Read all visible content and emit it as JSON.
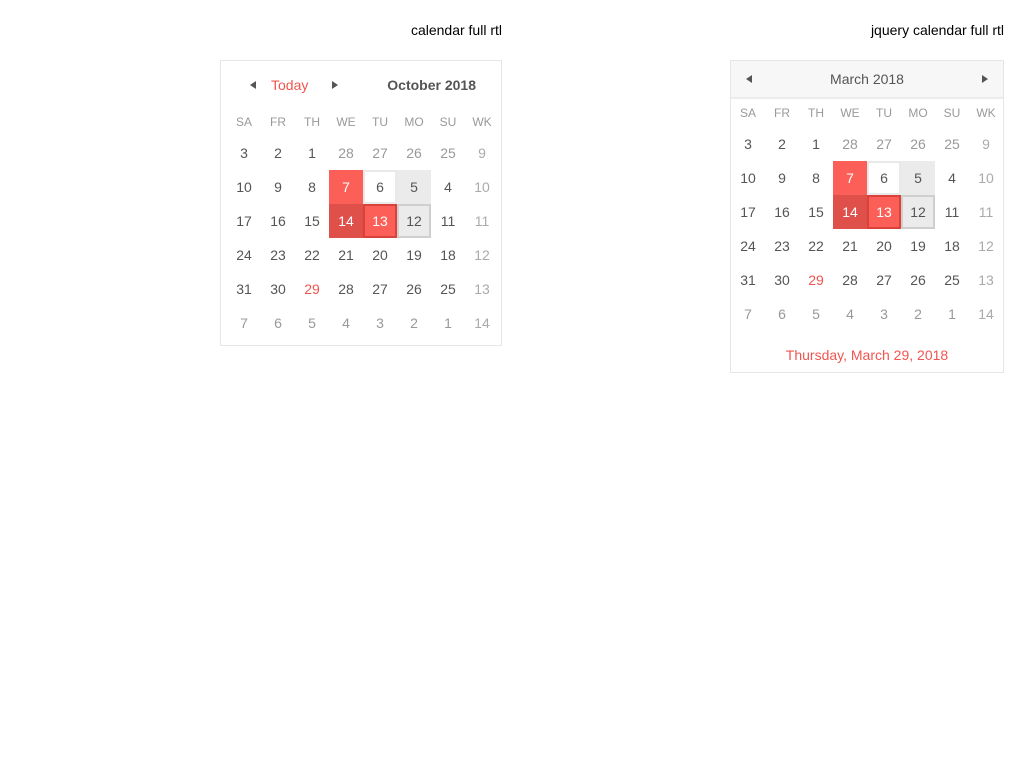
{
  "headings": {
    "left": "calendar full rtl",
    "right": "jquery calendar full rtl"
  },
  "calendar1": {
    "today_label": "Today",
    "month_label": "October 2018",
    "weekdays": [
      "SA",
      "FR",
      "TH",
      "WE",
      "TU",
      "MO",
      "SU",
      "WK"
    ],
    "weeks": [
      [
        {
          "d": "3"
        },
        {
          "d": "2"
        },
        {
          "d": "1"
        },
        {
          "d": "28",
          "s": "muted"
        },
        {
          "d": "27",
          "s": "muted"
        },
        {
          "d": "26",
          "s": "muted"
        },
        {
          "d": "25",
          "s": "muted"
        },
        {
          "d": "9",
          "s": "wk"
        }
      ],
      [
        {
          "d": "10"
        },
        {
          "d": "9"
        },
        {
          "d": "8"
        },
        {
          "d": "7",
          "s": "sel-red"
        },
        {
          "d": "6",
          "s": "outline"
        },
        {
          "d": "5",
          "s": "grey"
        },
        {
          "d": "4"
        },
        {
          "d": "10",
          "s": "wk"
        }
      ],
      [
        {
          "d": "17"
        },
        {
          "d": "16"
        },
        {
          "d": "15"
        },
        {
          "d": "14",
          "s": "sel-dark"
        },
        {
          "d": "13",
          "s": "sel-red-border"
        },
        {
          "d": "12",
          "s": "grey-border"
        },
        {
          "d": "11"
        },
        {
          "d": "11",
          "s": "wk"
        }
      ],
      [
        {
          "d": "24"
        },
        {
          "d": "23"
        },
        {
          "d": "22"
        },
        {
          "d": "21"
        },
        {
          "d": "20"
        },
        {
          "d": "19"
        },
        {
          "d": "18"
        },
        {
          "d": "12",
          "s": "wk"
        }
      ],
      [
        {
          "d": "31"
        },
        {
          "d": "30"
        },
        {
          "d": "29",
          "s": "red-text"
        },
        {
          "d": "28"
        },
        {
          "d": "27"
        },
        {
          "d": "26"
        },
        {
          "d": "25"
        },
        {
          "d": "13",
          "s": "wk"
        }
      ],
      [
        {
          "d": "7",
          "s": "muted"
        },
        {
          "d": "6",
          "s": "muted"
        },
        {
          "d": "5",
          "s": "muted"
        },
        {
          "d": "4",
          "s": "muted"
        },
        {
          "d": "3",
          "s": "muted"
        },
        {
          "d": "2",
          "s": "muted"
        },
        {
          "d": "1",
          "s": "muted"
        },
        {
          "d": "14",
          "s": "wk"
        }
      ]
    ]
  },
  "calendar2": {
    "month_label": "March 2018",
    "weekdays": [
      "SA",
      "FR",
      "TH",
      "WE",
      "TU",
      "MO",
      "SU",
      "WK"
    ],
    "weeks": [
      [
        {
          "d": "3"
        },
        {
          "d": "2"
        },
        {
          "d": "1"
        },
        {
          "d": "28",
          "s": "muted"
        },
        {
          "d": "27",
          "s": "muted"
        },
        {
          "d": "26",
          "s": "muted"
        },
        {
          "d": "25",
          "s": "muted"
        },
        {
          "d": "9",
          "s": "wk"
        }
      ],
      [
        {
          "d": "10"
        },
        {
          "d": "9"
        },
        {
          "d": "8"
        },
        {
          "d": "7",
          "s": "sel-red"
        },
        {
          "d": "6",
          "s": "outline"
        },
        {
          "d": "5",
          "s": "grey"
        },
        {
          "d": "4"
        },
        {
          "d": "10",
          "s": "wk"
        }
      ],
      [
        {
          "d": "17"
        },
        {
          "d": "16"
        },
        {
          "d": "15"
        },
        {
          "d": "14",
          "s": "sel-dark"
        },
        {
          "d": "13",
          "s": "sel-red-border"
        },
        {
          "d": "12",
          "s": "grey-border"
        },
        {
          "d": "11"
        },
        {
          "d": "11",
          "s": "wk"
        }
      ],
      [
        {
          "d": "24"
        },
        {
          "d": "23"
        },
        {
          "d": "22"
        },
        {
          "d": "21"
        },
        {
          "d": "20"
        },
        {
          "d": "19"
        },
        {
          "d": "18"
        },
        {
          "d": "12",
          "s": "wk"
        }
      ],
      [
        {
          "d": "31"
        },
        {
          "d": "30"
        },
        {
          "d": "29",
          "s": "red-text"
        },
        {
          "d": "28"
        },
        {
          "d": "27"
        },
        {
          "d": "26"
        },
        {
          "d": "25"
        },
        {
          "d": "13",
          "s": "wk"
        }
      ],
      [
        {
          "d": "7",
          "s": "muted"
        },
        {
          "d": "6",
          "s": "muted"
        },
        {
          "d": "5",
          "s": "muted"
        },
        {
          "d": "4",
          "s": "muted"
        },
        {
          "d": "3",
          "s": "muted"
        },
        {
          "d": "2",
          "s": "muted"
        },
        {
          "d": "1",
          "s": "muted"
        },
        {
          "d": "14",
          "s": "wk"
        }
      ]
    ],
    "footer_date": "Thursday, March 29, 2018"
  },
  "icons": {
    "prev": "triangle-left-icon",
    "next": "triangle-right-icon"
  },
  "colors": {
    "accent": "#f0554f",
    "selected": "#fb5f57",
    "selected_dark": "#e0504b",
    "muted_text": "#999999"
  }
}
